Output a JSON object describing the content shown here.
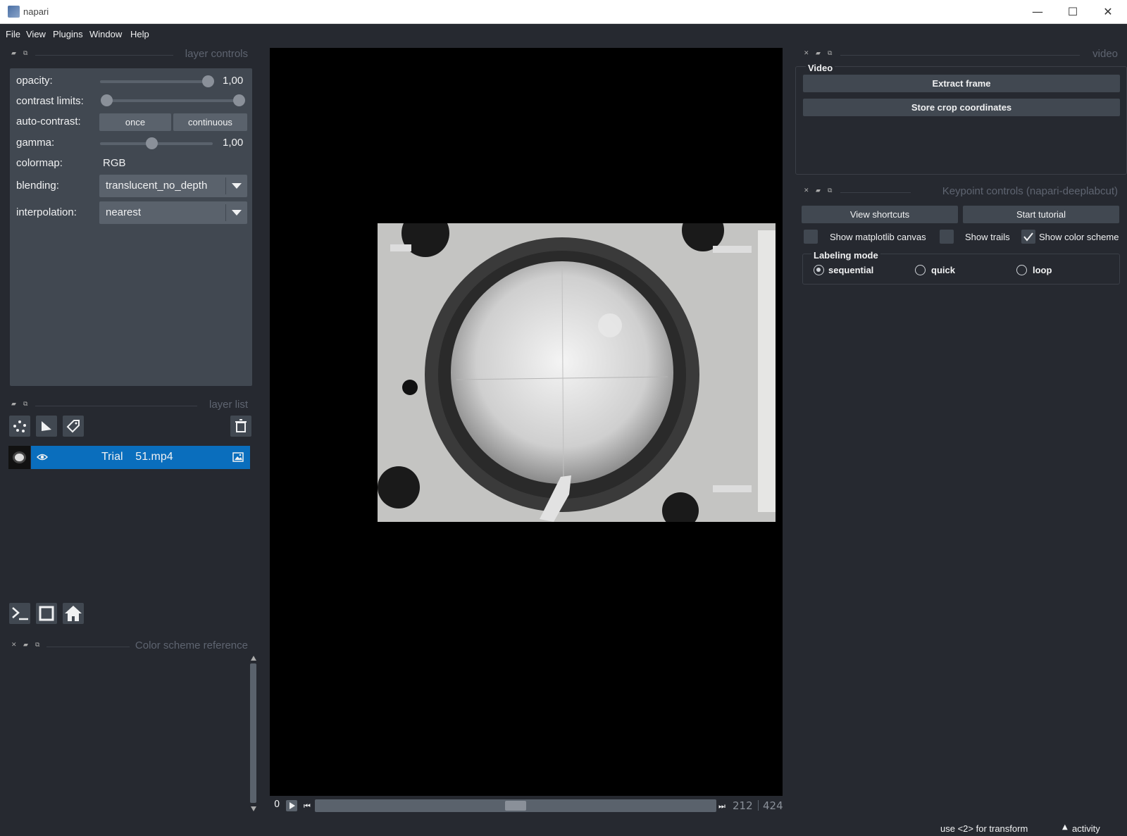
{
  "window": {
    "title": "napari"
  },
  "menu": [
    "File",
    "View",
    "Plugins",
    "Window",
    "Help"
  ],
  "layer_controls": {
    "title": "layer controls",
    "opacity_label": "opacity:",
    "opacity_value": "1,00",
    "opacity_level": 1.0,
    "contrast_label": "contrast limits:",
    "autocontrast_label": "auto-contrast:",
    "once_label": "once",
    "continuous_label": "continuous",
    "gamma_label": "gamma:",
    "gamma_value": "1,00",
    "colormap_label": "colormap:",
    "colormap_value": "RGB",
    "blending_label": "blending:",
    "blending_value": "translucent_no_depth",
    "interpolation_label": "interpolation:",
    "interpolation_value": "nearest"
  },
  "layer_list": {
    "title": "layer list",
    "layers": [
      {
        "name": "Trial    51.mp4",
        "visible": true,
        "selected": true
      }
    ]
  },
  "color_scheme": {
    "title": "Color scheme reference"
  },
  "dims": {
    "current": "0",
    "frame": "212",
    "total": "424"
  },
  "video_widget": {
    "title": "video",
    "group_title": "Video",
    "extract_label": "Extract frame",
    "store_label": "Store crop coordinates"
  },
  "keypoint_controls": {
    "title": "Keypoint controls (napari-deeplabcut)",
    "view_shortcuts": "View shortcuts",
    "start_tutorial": "Start tutorial",
    "show_matplotlib": "Show matplotlib canvas",
    "show_matplotlib_checked": false,
    "show_trails": "Show trails",
    "show_trails_checked": false,
    "show_color_scheme": "Show color scheme",
    "show_color_scheme_checked": true,
    "labeling_mode_title": "Labeling mode",
    "modes": [
      "sequential",
      "quick",
      "loop"
    ],
    "selected_mode": "sequential"
  },
  "status": {
    "hint": "use <2> for transform",
    "activity": "activity"
  },
  "colors": {
    "background": "#262930",
    "panel": "#414851",
    "button": "#5a626c",
    "highlight": "#0a6ebd",
    "text": "#f0f1f2"
  }
}
